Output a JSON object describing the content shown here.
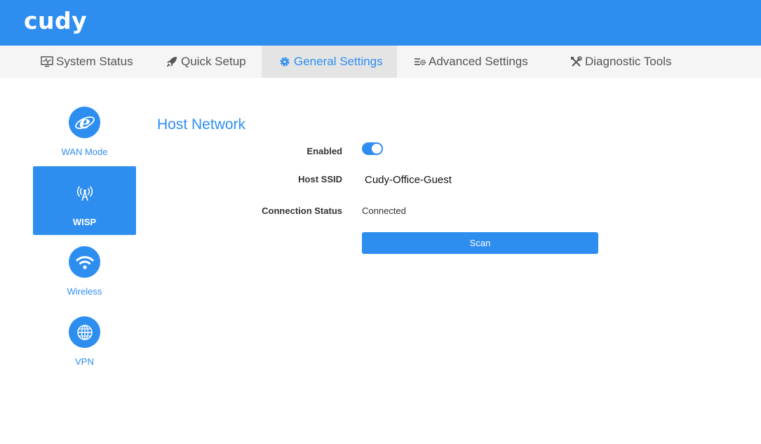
{
  "header": {
    "logo_text": "cudy",
    "brand_color": "#2e8ef0"
  },
  "nav": {
    "tabs": [
      {
        "label": "System Status",
        "icon": "monitor-icon",
        "active": false
      },
      {
        "label": "Quick Setup",
        "icon": "rocket-icon",
        "active": false
      },
      {
        "label": "General Settings",
        "icon": "gear-icon",
        "active": true
      },
      {
        "label": "Advanced Settings",
        "icon": "sliders-gear-icon",
        "active": false
      },
      {
        "label": "Diagnostic Tools",
        "icon": "tools-icon",
        "active": false
      }
    ]
  },
  "sidebar": {
    "items": [
      {
        "label": "WAN Mode",
        "icon": "internet-explorer-icon",
        "active": false
      },
      {
        "label": "WISP",
        "icon": "antenna-icon",
        "active": true
      },
      {
        "label": "Wireless",
        "icon": "wifi-icon",
        "active": false
      },
      {
        "label": "VPN",
        "icon": "globe-icon",
        "active": false
      }
    ]
  },
  "main": {
    "title": "Host Network",
    "fields": {
      "enabled_label": "Enabled",
      "enabled_value": true,
      "ssid_label": "Host SSID",
      "ssid_value": "Cudy-Office-Guest",
      "status_label": "Connection Status",
      "status_value": "Connected"
    },
    "scan_label": "Scan"
  }
}
